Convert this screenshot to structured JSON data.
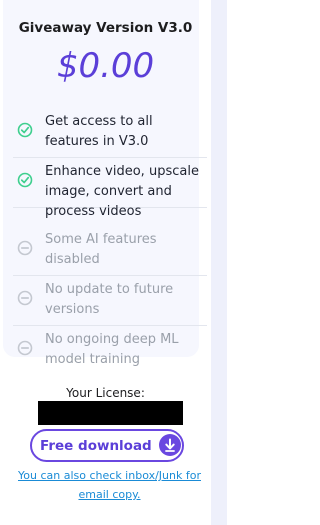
{
  "plan": {
    "title": "Giveaway Version V3.0",
    "price": "$0.00"
  },
  "features": [
    {
      "text": "Get access to all features in V3.0",
      "enabled": true,
      "icon": "check-circle-icon"
    },
    {
      "text": "Enhance video, upscale image, convert and process videos",
      "enabled": true,
      "icon": "check-circle-icon"
    },
    {
      "text": "Some AI features disabled",
      "enabled": false,
      "icon": "minus-circle-icon"
    },
    {
      "text": "No update to future versions",
      "enabled": false,
      "icon": "minus-circle-icon"
    },
    {
      "text": "No ongoing deep ML model training",
      "enabled": false,
      "icon": "minus-circle-icon"
    }
  ],
  "license": {
    "label": "Your License:"
  },
  "download": {
    "label": "Free download",
    "icon": "download-arrow-icon"
  },
  "note": "You can also check inbox/Junk for email copy.",
  "colors": {
    "accent": "#5b3fd8",
    "check": "#3ecf8e",
    "disabled": "#c4c8d0",
    "link": "#1a8bd6"
  }
}
